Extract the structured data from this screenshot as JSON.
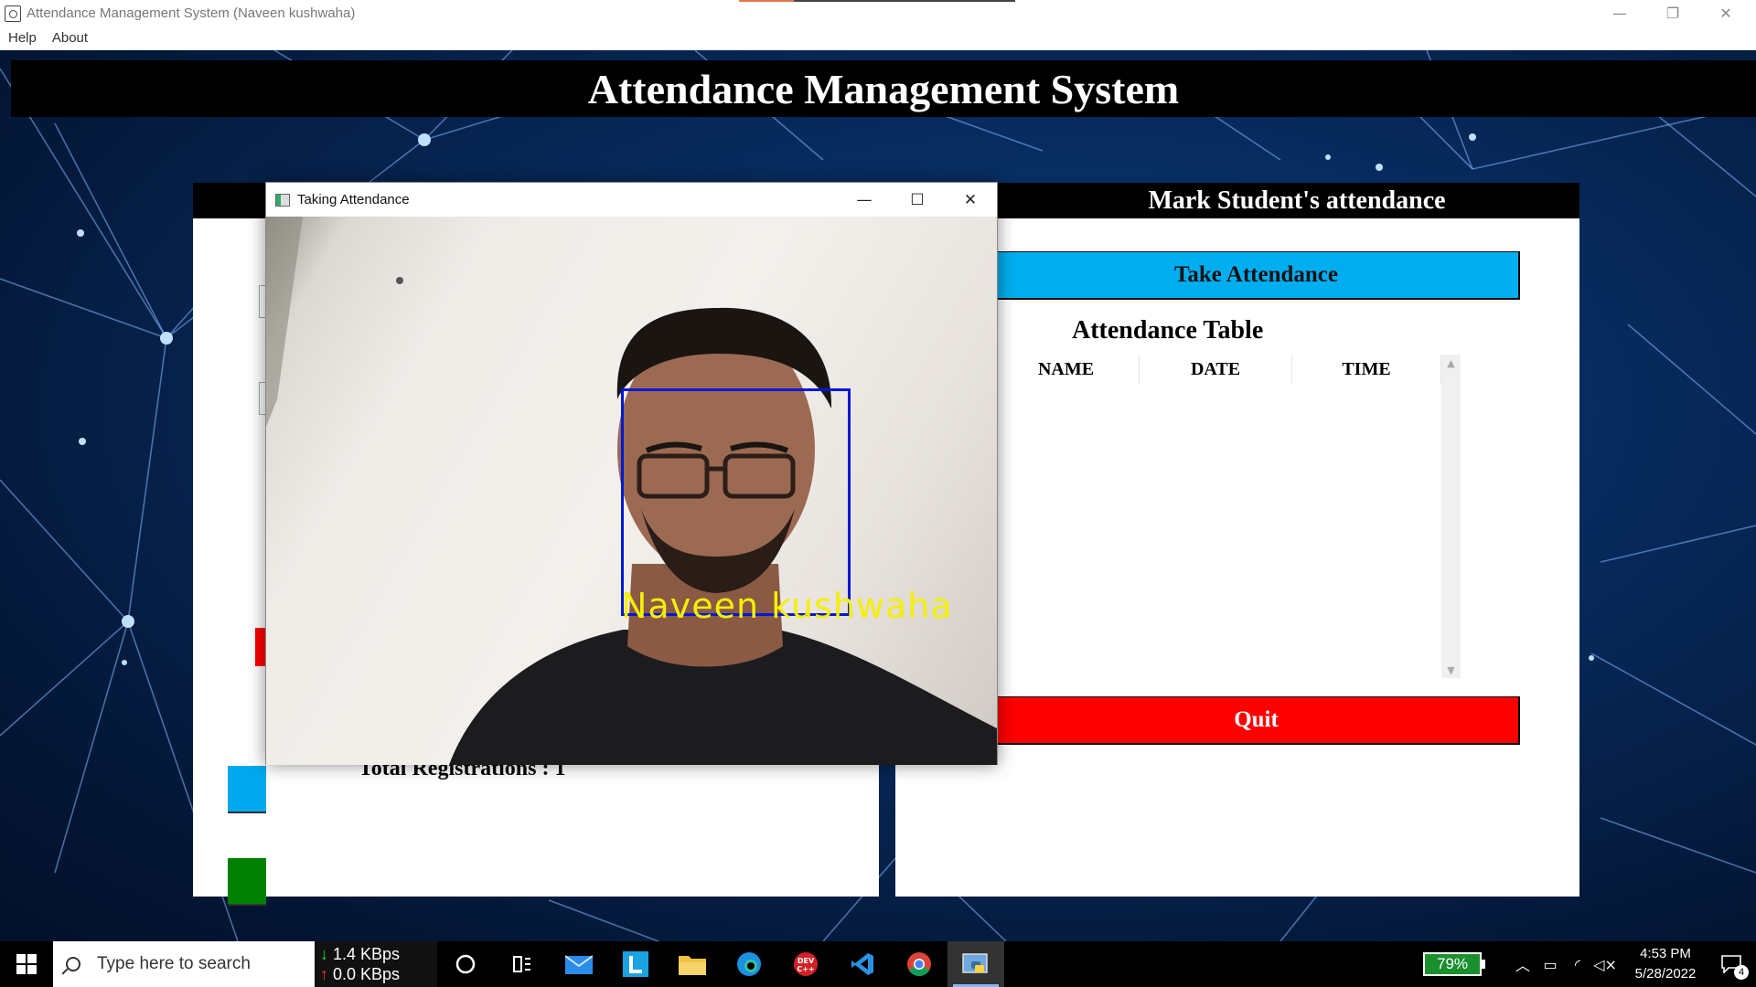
{
  "window": {
    "title": "Attendance Management System (Naveen kushwaha)",
    "minimize": "—",
    "restore": "❐",
    "close": "✕"
  },
  "menu": {
    "help": "Help",
    "about": "About"
  },
  "banner": {
    "title": "Attendance Management System"
  },
  "left_panel": {
    "total_registrations": "Total Registrations : 1"
  },
  "right_panel": {
    "header": "Mark Student's attendance",
    "take_attendance_label": "Take Attendance",
    "table_title": "Attendance Table",
    "columns": [
      "NAME",
      "DATE",
      "TIME"
    ],
    "rows": [],
    "quit_label": "Quit"
  },
  "camera_window": {
    "title": "Taking Attendance",
    "minimize": "—",
    "maximize": "☐",
    "close": "✕",
    "recognized_name": "Naveen kushwaha"
  },
  "taskbar": {
    "search_placeholder": "Type here to search",
    "net_down": "1.4 KBps",
    "net_up": "0.0 KBps",
    "battery": "79%",
    "time": "4:53 PM",
    "date": "5/28/2022",
    "notification_count": "4",
    "apps": [
      "cortana-icon",
      "task-view-icon",
      "mail-icon",
      "l-app-icon",
      "file-explorer-icon",
      "edge-icon",
      "devcpp-icon",
      "vscode-icon",
      "chrome-icon",
      "python-icon"
    ]
  },
  "colors": {
    "take_attendance_button": "#00aeef",
    "quit_button": "#ff0000",
    "face_box": "#0018d6",
    "face_label": "#f4f000",
    "battery": "#1a8f2e"
  }
}
